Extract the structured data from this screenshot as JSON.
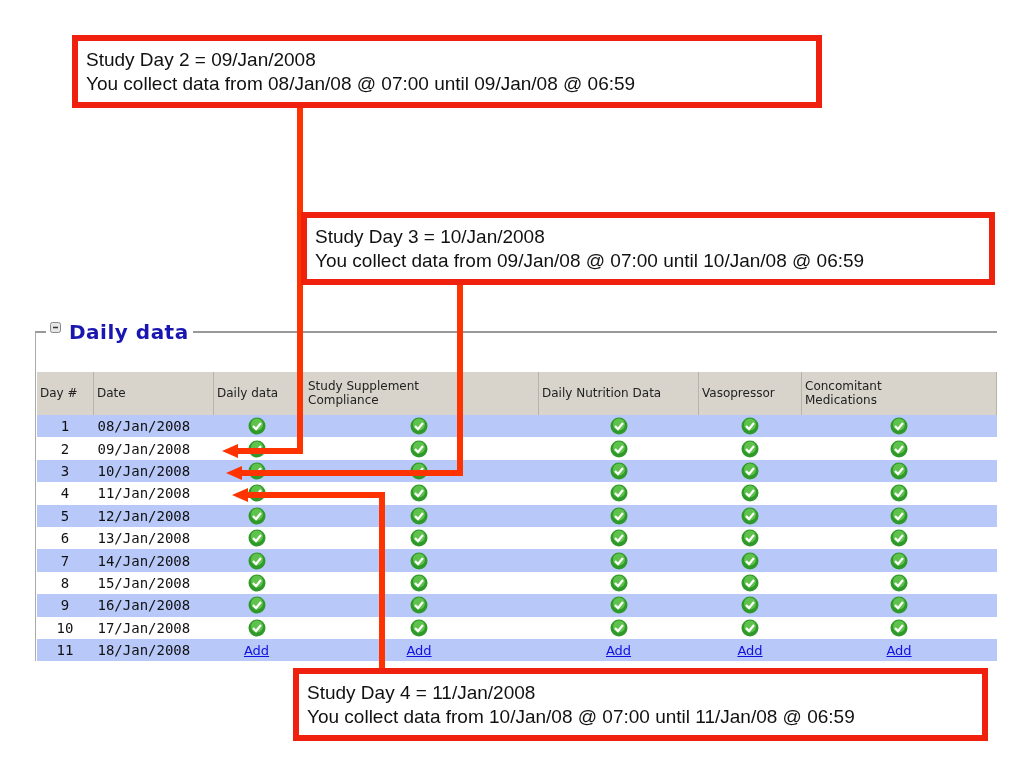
{
  "panel": {
    "title": "Daily data",
    "expanded": true
  },
  "table": {
    "columns": [
      "Day #",
      "Date",
      "Daily data",
      "Study Supplement Compliance",
      "Daily Nutrition Data",
      "Vasopressor",
      "Concomitant Medications"
    ],
    "rows": [
      {
        "cells": [
          {
            "kind": "number",
            "text": "1"
          },
          {
            "kind": "date",
            "text": "08/Jan/2008"
          },
          {
            "kind": "check"
          },
          {
            "kind": "check"
          },
          {
            "kind": "check"
          },
          {
            "kind": "check"
          },
          {
            "kind": "check"
          }
        ]
      },
      {
        "cells": [
          {
            "kind": "number",
            "text": "2"
          },
          {
            "kind": "date",
            "text": "09/Jan/2008"
          },
          {
            "kind": "check"
          },
          {
            "kind": "check"
          },
          {
            "kind": "check"
          },
          {
            "kind": "check"
          },
          {
            "kind": "check"
          }
        ]
      },
      {
        "cells": [
          {
            "kind": "number",
            "text": "3"
          },
          {
            "kind": "date",
            "text": "10/Jan/2008"
          },
          {
            "kind": "check"
          },
          {
            "kind": "check"
          },
          {
            "kind": "check"
          },
          {
            "kind": "check"
          },
          {
            "kind": "check"
          }
        ]
      },
      {
        "cells": [
          {
            "kind": "number",
            "text": "4"
          },
          {
            "kind": "date",
            "text": "11/Jan/2008"
          },
          {
            "kind": "check"
          },
          {
            "kind": "check"
          },
          {
            "kind": "check"
          },
          {
            "kind": "check"
          },
          {
            "kind": "check"
          }
        ]
      },
      {
        "cells": [
          {
            "kind": "number",
            "text": "5"
          },
          {
            "kind": "date",
            "text": "12/Jan/2008"
          },
          {
            "kind": "check"
          },
          {
            "kind": "check"
          },
          {
            "kind": "check"
          },
          {
            "kind": "check"
          },
          {
            "kind": "check"
          }
        ]
      },
      {
        "cells": [
          {
            "kind": "number",
            "text": "6"
          },
          {
            "kind": "date",
            "text": "13/Jan/2008"
          },
          {
            "kind": "check"
          },
          {
            "kind": "check"
          },
          {
            "kind": "check"
          },
          {
            "kind": "check"
          },
          {
            "kind": "check"
          }
        ]
      },
      {
        "cells": [
          {
            "kind": "number",
            "text": "7"
          },
          {
            "kind": "date",
            "text": "14/Jan/2008"
          },
          {
            "kind": "check"
          },
          {
            "kind": "check"
          },
          {
            "kind": "check"
          },
          {
            "kind": "check"
          },
          {
            "kind": "check"
          }
        ]
      },
      {
        "cells": [
          {
            "kind": "number",
            "text": "8"
          },
          {
            "kind": "date",
            "text": "15/Jan/2008"
          },
          {
            "kind": "check"
          },
          {
            "kind": "check"
          },
          {
            "kind": "check"
          },
          {
            "kind": "check"
          },
          {
            "kind": "check"
          }
        ]
      },
      {
        "cells": [
          {
            "kind": "number",
            "text": "9"
          },
          {
            "kind": "date",
            "text": "16/Jan/2008"
          },
          {
            "kind": "check"
          },
          {
            "kind": "check"
          },
          {
            "kind": "check"
          },
          {
            "kind": "check"
          },
          {
            "kind": "check"
          }
        ]
      },
      {
        "cells": [
          {
            "kind": "number",
            "text": "10"
          },
          {
            "kind": "date",
            "text": "17/Jan/2008"
          },
          {
            "kind": "check"
          },
          {
            "kind": "check"
          },
          {
            "kind": "check"
          },
          {
            "kind": "check"
          },
          {
            "kind": "check"
          }
        ]
      },
      {
        "cells": [
          {
            "kind": "number",
            "text": "11"
          },
          {
            "kind": "date",
            "text": "18/Jan/2008"
          },
          {
            "kind": "link",
            "text": "Add"
          },
          {
            "kind": "link",
            "text": "Add"
          },
          {
            "kind": "link",
            "text": "Add"
          },
          {
            "kind": "link",
            "text": "Add"
          },
          {
            "kind": "link",
            "text": "Add"
          }
        ]
      }
    ]
  },
  "callouts": [
    {
      "line_1": "Study Day 2 = 09/Jan/2008",
      "line_2": "You collect data from 08/Jan/08 @ 07:00 until 09/Jan/08 @ 06:59"
    },
    {
      "line_1": "Study Day 3 = 10/Jan/2008",
      "line_2": "You collect data from 09/Jan/08 @ 07:00 until 10/Jan/08 @ 06:59"
    },
    {
      "line_1": "Study Day 4 = 11/Jan/2008",
      "line_2": "You collect data from 10/Jan/08 @ 07:00 until 11/Jan/08 @ 06:59"
    }
  ]
}
